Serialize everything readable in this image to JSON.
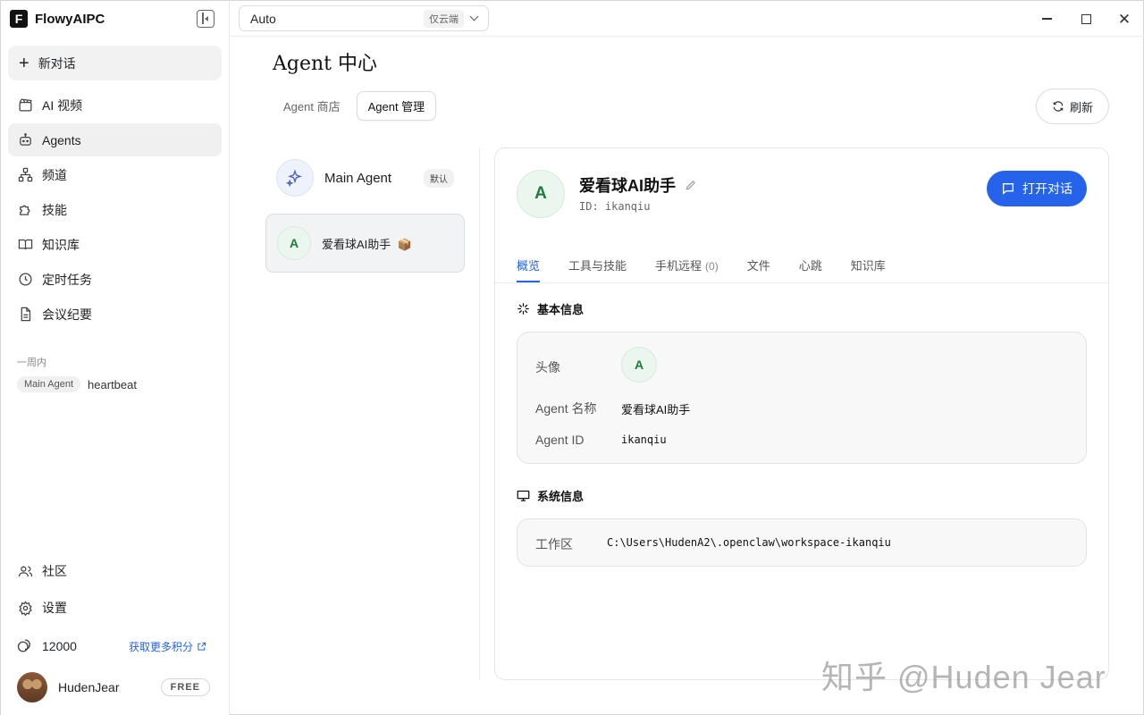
{
  "app": {
    "name": "FlowyAIPC",
    "logo_letter": "F"
  },
  "sidebar": {
    "new_chat": "新对话",
    "items": [
      {
        "label": "AI 视频",
        "icon": "video-clapper-icon"
      },
      {
        "label": "Agents",
        "icon": "robot-icon",
        "active": true
      },
      {
        "label": "频道",
        "icon": "channel-network-icon"
      },
      {
        "label": "技能",
        "icon": "puzzle-icon"
      },
      {
        "label": "知识库",
        "icon": "book-open-icon"
      },
      {
        "label": "定时任务",
        "icon": "clock-icon"
      },
      {
        "label": "会议纪要",
        "icon": "document-icon"
      }
    ],
    "week_label": "一周内",
    "recent": {
      "tag": "Main Agent",
      "title": "heartbeat"
    },
    "community": "社区",
    "settings": "设置",
    "credits": "12000",
    "get_more": "获取更多积分",
    "user_name": "HudenJear",
    "plan": "FREE"
  },
  "topbar": {
    "model": "Auto",
    "cloud_tag": "仅云端"
  },
  "main": {
    "title": "Agent 中心",
    "tabs": [
      "Agent 商店",
      "Agent 管理"
    ],
    "refresh": "刷新",
    "agents": [
      {
        "name": "Main Agent",
        "badge": "默认"
      },
      {
        "name": "爱看球AI助手",
        "emoji": "📦",
        "avatar_letter": "A"
      }
    ]
  },
  "detail": {
    "avatar_letter": "A",
    "name": "爱看球AI助手",
    "id_text": "ID: ikanqiu",
    "open_chat": "打开对话",
    "tabs": [
      {
        "label": "概览",
        "active": true
      },
      {
        "label": "工具与技能"
      },
      {
        "label": "手机远程",
        "count": "(0)"
      },
      {
        "label": "文件"
      },
      {
        "label": "心跳"
      },
      {
        "label": "知识库"
      }
    ],
    "basic_title": "基本信息",
    "basic": {
      "avatar_label": "头像",
      "name_label": "Agent 名称",
      "name_value": "爱看球AI助手",
      "id_label": "Agent ID",
      "id_value": "ikanqiu"
    },
    "system_title": "系统信息",
    "system": {
      "workspace_label": "工作区",
      "workspace_value": "C:\\Users\\HudenA2\\.openclaw\\workspace-ikanqiu"
    }
  },
  "watermark": "知乎 @Huden Jear",
  "colors": {
    "accent": "#2563eb",
    "avatar_green": "#1f7a3d"
  }
}
